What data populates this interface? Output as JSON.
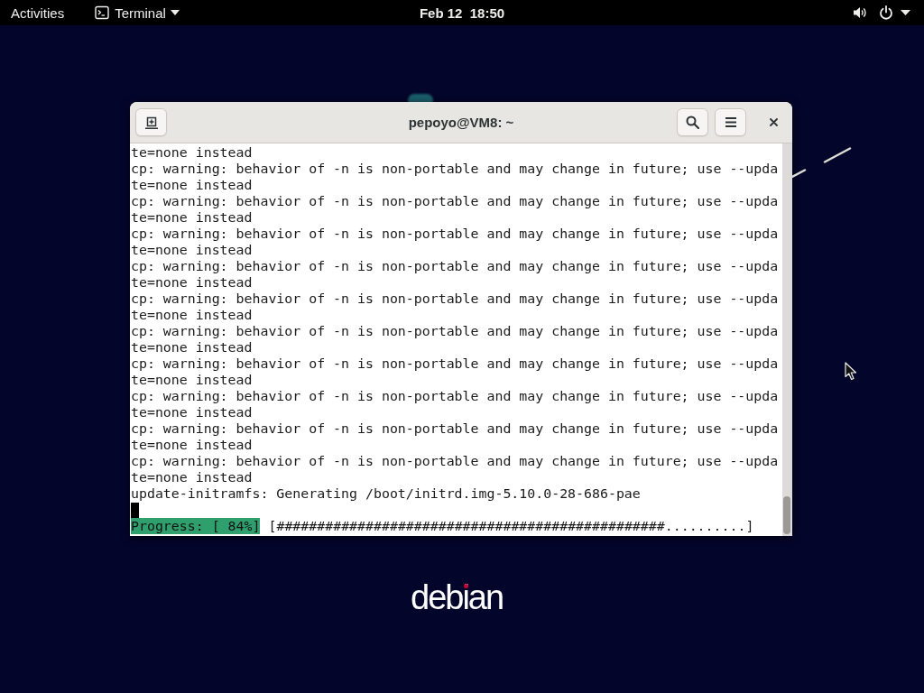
{
  "top_bar": {
    "activities": "Activities",
    "app_menu": "Terminal",
    "clock": "Feb 12  18:50"
  },
  "terminal": {
    "title": "pepoyo@VM8: ~",
    "lines": [
      {
        "kind": "text",
        "text": "te=none instead"
      },
      {
        "kind": "text",
        "text": "cp: warning: behavior of -n is non-portable and may change in future; use --upda"
      },
      {
        "kind": "text",
        "text": "te=none instead"
      },
      {
        "kind": "text",
        "text": "cp: warning: behavior of -n is non-portable and may change in future; use --upda"
      },
      {
        "kind": "text",
        "text": "te=none instead"
      },
      {
        "kind": "text",
        "text": "cp: warning: behavior of -n is non-portable and may change in future; use --upda"
      },
      {
        "kind": "text",
        "text": "te=none instead"
      },
      {
        "kind": "text",
        "text": "cp: warning: behavior of -n is non-portable and may change in future; use --upda"
      },
      {
        "kind": "text",
        "text": "te=none instead"
      },
      {
        "kind": "text",
        "text": "cp: warning: behavior of -n is non-portable and may change in future; use --upda"
      },
      {
        "kind": "text",
        "text": "te=none instead"
      },
      {
        "kind": "text",
        "text": "cp: warning: behavior of -n is non-portable and may change in future; use --upda"
      },
      {
        "kind": "text",
        "text": "te=none instead"
      },
      {
        "kind": "text",
        "text": "cp: warning: behavior of -n is non-portable and may change in future; use --upda"
      },
      {
        "kind": "text",
        "text": "te=none instead"
      },
      {
        "kind": "text",
        "text": "cp: warning: behavior of -n is non-portable and may change in future; use --upda"
      },
      {
        "kind": "text",
        "text": "te=none instead"
      },
      {
        "kind": "text",
        "text": "cp: warning: behavior of -n is non-portable and may change in future; use --upda"
      },
      {
        "kind": "text",
        "text": "te=none instead"
      },
      {
        "kind": "text",
        "text": "cp: warning: behavior of -n is non-portable and may change in future; use --upda"
      },
      {
        "kind": "text",
        "text": "te=none instead"
      },
      {
        "kind": "text",
        "text": "update-initramfs: Generating /boot/initrd.img-5.10.0-28-686-pae"
      },
      {
        "kind": "cursor"
      },
      {
        "kind": "progress",
        "label": "Progress: [ 84%]",
        "bar": "[################################################..........]"
      }
    ]
  },
  "desktop": {
    "logo": "debian"
  }
}
